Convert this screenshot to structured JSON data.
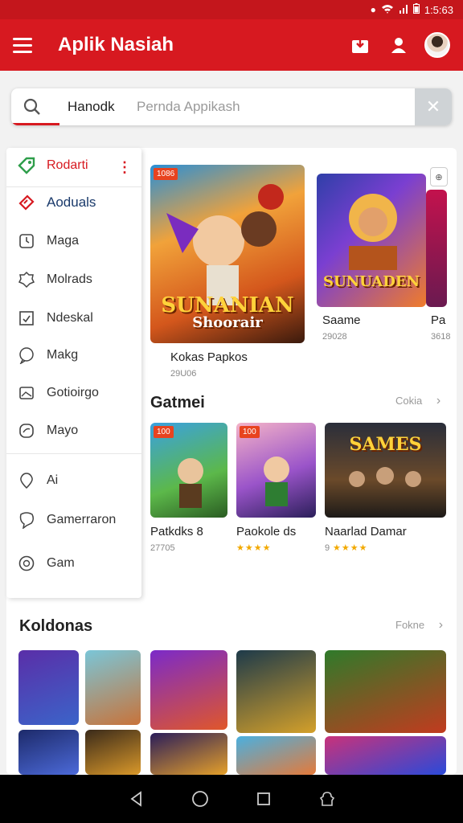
{
  "status_bar": {
    "time": "1:5:63",
    "icons": [
      "alarm-icon",
      "wifi-icon",
      "signal-icon",
      "battery-icon"
    ]
  },
  "app_bar": {
    "title": "Aplik Nasiah",
    "icons": [
      "menu-icon",
      "inbox-icon",
      "profile-icon",
      "avatar"
    ]
  },
  "search": {
    "value": "Hanodk",
    "placeholder": "Pernda Appikash"
  },
  "drawer": {
    "items": [
      {
        "label": "Rodarti",
        "icon": "tag-icon"
      },
      {
        "label": "Aoduals",
        "icon": "ticket-icon"
      },
      {
        "label": "Maga",
        "icon": "clock-icon"
      },
      {
        "label": "Molrads",
        "icon": "badge-icon"
      },
      {
        "label": "Ndeskal",
        "icon": "check-square-icon"
      },
      {
        "label": "Makg",
        "icon": "chat-icon"
      },
      {
        "label": "Gotioirgo",
        "icon": "image-icon"
      },
      {
        "label": "Mayo",
        "icon": "leaf-icon"
      },
      {
        "label": "Ai",
        "icon": "pin-icon"
      },
      {
        "label": "Gamerraron",
        "icon": "bubble-icon"
      },
      {
        "label": "Gam",
        "icon": "whatsapp-icon"
      }
    ]
  },
  "featured": [
    {
      "badge": "1086",
      "art_title": "SUNANIAN",
      "art_subtitle": "Shoorair",
      "name": "Kokas Papkos",
      "meta": "29U06"
    },
    {
      "art_title": "SUNUADEN",
      "name": "Saame",
      "meta": "29028"
    },
    {
      "name": "Pa",
      "meta": "3618"
    }
  ],
  "games_section": {
    "title": "Gatmei",
    "more": "Cokia",
    "items": [
      {
        "badge": "100",
        "name": "Patkdks 8",
        "meta": "27705"
      },
      {
        "badge": "100",
        "name": "Paokole ds",
        "stars": "★★★★"
      },
      {
        "art_title": "SAMES",
        "name": "Naarlad Damar",
        "stars": "★★★★",
        "meta_prefix": "9"
      }
    ]
  },
  "koldonas_section": {
    "title": "Koldonas",
    "more": "Fokne"
  },
  "nav": {
    "buttons": [
      "back-icon",
      "home-icon",
      "recents-icon",
      "assistant-icon"
    ]
  },
  "colors": {
    "brand": "#d71920",
    "status_bar": "#c4161c"
  }
}
